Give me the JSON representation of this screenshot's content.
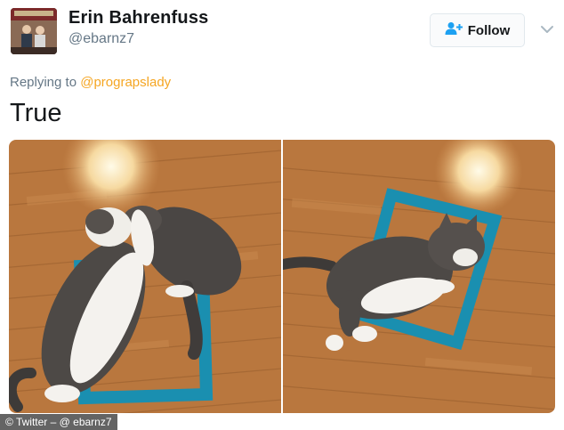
{
  "user": {
    "display_name": "Erin Bahrenfuss",
    "handle": "@ebarnz7"
  },
  "follow": {
    "label": "Follow"
  },
  "icons": {
    "follow": "add-person-icon",
    "more": "chevron-down-icon"
  },
  "reply": {
    "prefix": "Replying to",
    "mention": "@prograpslady"
  },
  "tweet": {
    "text": "True"
  },
  "credit": {
    "text": "© Twitter – @ ebarnz7"
  },
  "colors": {
    "accent": "#1da1f2",
    "mention": "#f5a623",
    "tape": "#1a8fb0",
    "floor": "#b9773e"
  }
}
